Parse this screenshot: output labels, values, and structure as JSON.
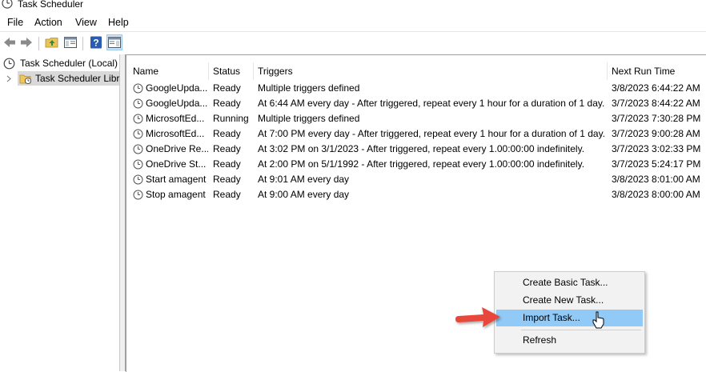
{
  "window": {
    "title": "Task Scheduler"
  },
  "menu": [
    "File",
    "Action",
    "View",
    "Help"
  ],
  "toolbar": {
    "icons": [
      "back-arrow-icon",
      "forward-arrow-icon",
      "up-folder-icon",
      "show-hide-console-tree-icon",
      "help-icon",
      "show-hide-action-pane-icon"
    ]
  },
  "tree": {
    "root": "Task Scheduler (Local)",
    "child": "Task Scheduler Library"
  },
  "columns": {
    "name": "Name",
    "status": "Status",
    "triggers": "Triggers",
    "next_run": "Next Run Time"
  },
  "tasks": [
    {
      "name": "GoogleUpda...",
      "status": "Ready",
      "triggers": "Multiple triggers defined",
      "next_run": "3/8/2023 6:44:22 AM"
    },
    {
      "name": "GoogleUpda...",
      "status": "Ready",
      "triggers": "At 6:44 AM every day - After triggered, repeat every 1 hour for a duration of 1 day.",
      "next_run": "3/7/2023 8:44:22 AM"
    },
    {
      "name": "MicrosoftEd...",
      "status": "Running",
      "triggers": "Multiple triggers defined",
      "next_run": "3/7/2023 7:30:28 PM"
    },
    {
      "name": "MicrosoftEd...",
      "status": "Ready",
      "triggers": "At 7:00 PM every day - After triggered, repeat every 1 hour for a duration of 1 day.",
      "next_run": "3/7/2023 9:00:28 AM"
    },
    {
      "name": "OneDrive Re...",
      "status": "Ready",
      "triggers": "At 3:02 PM on 3/1/2023 - After triggered, repeat every 1.00:00:00 indefinitely.",
      "next_run": "3/7/2023 3:02:33 PM"
    },
    {
      "name": "OneDrive St...",
      "status": "Ready",
      "triggers": "At 2:00 PM on 5/1/1992 - After triggered, repeat every 1.00:00:00 indefinitely.",
      "next_run": "3/7/2023 5:24:17 PM"
    },
    {
      "name": "Start amagent",
      "status": "Ready",
      "triggers": "At 9:01 AM every day",
      "next_run": "3/8/2023 8:01:00 AM"
    },
    {
      "name": "Stop amagent",
      "status": "Ready",
      "triggers": "At 9:00 AM every day",
      "next_run": "3/8/2023 8:00:00 AM"
    }
  ],
  "context_menu": {
    "items": [
      "Create Basic Task...",
      "Create New Task...",
      "Import Task...",
      "Refresh"
    ],
    "highlighted": "Import Task..."
  },
  "colors": {
    "highlight": "#91c9f7",
    "arrow": "#e8473b"
  }
}
